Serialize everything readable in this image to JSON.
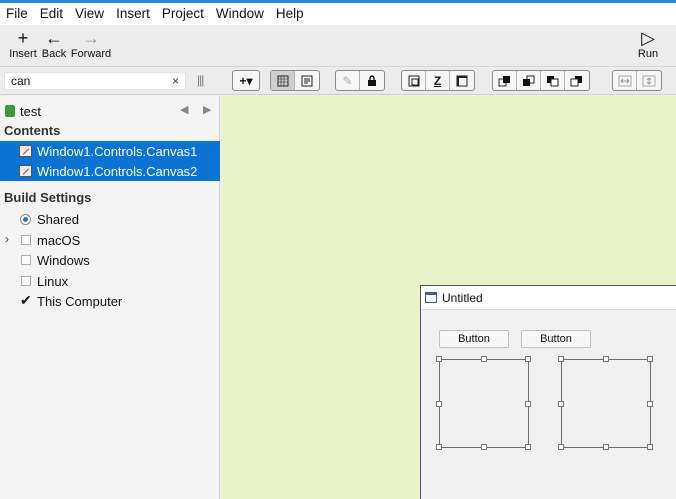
{
  "menu": [
    "File",
    "Edit",
    "View",
    "Insert",
    "Project",
    "Window",
    "Help"
  ],
  "toolbar": {
    "insert": {
      "label": "Insert",
      "icon": "plus-icon",
      "glyph": "+"
    },
    "back": {
      "label": "Back",
      "icon": "arrow-left-icon",
      "glyph": "←"
    },
    "forward": {
      "label": "Forward",
      "icon": "arrow-right-icon",
      "glyph": "→"
    },
    "run": {
      "label": "Run",
      "icon": "play-icon",
      "glyph": "▷"
    }
  },
  "search": {
    "value": "can",
    "clear_glyph": "×"
  },
  "project": {
    "name": "test",
    "back_glyph": "◀",
    "forward_glyph": "▶"
  },
  "contents": {
    "header": "Contents",
    "items": [
      {
        "label": "Window1.Controls.Canvas1",
        "selected": true
      },
      {
        "label": "Window1.Controls.Canvas2",
        "selected": true
      }
    ]
  },
  "build": {
    "header": "Build Settings",
    "items": [
      {
        "label": "Shared",
        "kind": "radio",
        "checked": true
      },
      {
        "label": "macOS",
        "kind": "checkbox",
        "checked": false,
        "expandable": true
      },
      {
        "label": "Windows",
        "kind": "checkbox",
        "checked": false
      },
      {
        "label": "Linux",
        "kind": "checkbox",
        "checked": false
      },
      {
        "label": "This Computer",
        "kind": "checkbox",
        "checked": true
      }
    ]
  },
  "editor_toolbar": {
    "add_glyph": "+▾",
    "lock_glyph": "🔒",
    "pencil_glyph": "✎"
  },
  "layout_window": {
    "title": "Untitled",
    "buttons": [
      "Button",
      "Button"
    ]
  },
  "colors": {
    "selection": "#0a73d4",
    "canvas_background": "#eaf3c8",
    "accent": "#2f86d8"
  }
}
